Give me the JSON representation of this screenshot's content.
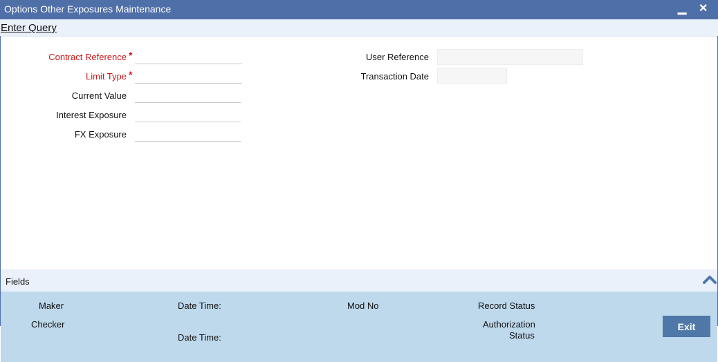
{
  "window": {
    "title": "Options Other Exposures Maintenance",
    "minimize_glyph": "▁",
    "close_glyph": "✕"
  },
  "menu": {
    "enter_query": "Enter Query"
  },
  "form": {
    "contract_reference": {
      "label": "Contract Reference",
      "required": "*",
      "value": ""
    },
    "limit_type": {
      "label": "Limit Type",
      "required": "*",
      "value": ""
    },
    "current_value": {
      "label": "Current Value",
      "value": ""
    },
    "interest_exposure": {
      "label": "Interest Exposure",
      "value": ""
    },
    "fx_exposure": {
      "label": "FX Exposure",
      "value": ""
    },
    "user_reference": {
      "label": "User Reference",
      "value": ""
    },
    "transaction_date": {
      "label": "Transaction Date",
      "value": ""
    }
  },
  "fields_bar": {
    "label": "Fields"
  },
  "audit": {
    "maker": "Maker",
    "checker": "Checker",
    "date_time_1": "Date Time:",
    "date_time_2": "Date Time:",
    "mod_no": "Mod No",
    "record_status": "Record Status",
    "authorization_status_line1": "Authorization",
    "authorization_status_line2": "Status",
    "exit_label": "Exit"
  },
  "colors": {
    "title_bar": "#4f6fa9",
    "required_label": "#cc1a1a",
    "audit_panel": "#bed8ec",
    "exit_button": "#4f78a9"
  }
}
